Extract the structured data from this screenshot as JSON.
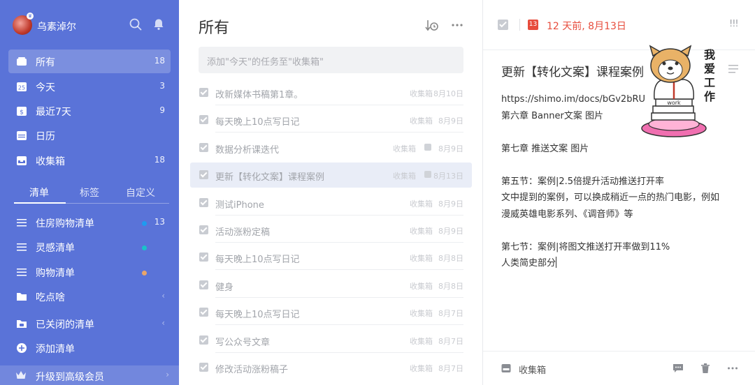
{
  "user": {
    "name": "乌素淖尔"
  },
  "sidebar": {
    "smart_lists": [
      {
        "label": "所有",
        "count": "18"
      },
      {
        "label": "今天",
        "count": "3"
      },
      {
        "label": "最近7天",
        "count": "9"
      },
      {
        "label": "日历",
        "count": ""
      },
      {
        "label": "收集箱",
        "count": "18"
      }
    ],
    "tabs": [
      "清单",
      "标签",
      "自定义"
    ],
    "lists": [
      {
        "label": "住房购物清单",
        "count": "13",
        "dot_color": "#1e9bf0"
      },
      {
        "label": "灵感清单",
        "count": "",
        "dot_color": "#19c3c9"
      },
      {
        "label": "购物清单",
        "count": "",
        "dot_color": "#e9a56a"
      }
    ],
    "folders": [
      {
        "label": "吃点啥"
      },
      {
        "label": "已关闭的清单"
      }
    ],
    "add_list": "添加清单",
    "upgrade": "升级到高级会员",
    "today_icon_day": "25"
  },
  "middle": {
    "title": "所有",
    "add_placeholder": "添加\"今天\"的任务至\"收集箱\"",
    "tasks": [
      {
        "title": "改新媒体书稿第1章。",
        "list": "收集箱",
        "date": "8月10日",
        "note": false
      },
      {
        "title": "每天晚上10点写日记",
        "list": "收集箱",
        "date": "8月9日",
        "note": false
      },
      {
        "title": "数据分析课迭代",
        "list": "收集箱",
        "date": "8月9日",
        "note": true
      },
      {
        "title": "更新【转化文案】课程案例",
        "list": "收集箱",
        "date": "8月13日",
        "note": true
      },
      {
        "title": "测试iPhone",
        "list": "收集箱",
        "date": "8月9日",
        "note": false
      },
      {
        "title": "活动涨粉定稿",
        "list": "收集箱",
        "date": "8月9日",
        "note": false
      },
      {
        "title": "每天晚上10点写日记",
        "list": "收集箱",
        "date": "8月8日",
        "note": false
      },
      {
        "title": "健身",
        "list": "收集箱",
        "date": "8月8日",
        "note": false
      },
      {
        "title": "每天晚上10点写日记",
        "list": "收集箱",
        "date": "8月7日",
        "note": false
      },
      {
        "title": "写公众号文章",
        "list": "收集箱",
        "date": "8月7日",
        "note": false
      },
      {
        "title": "修改活动涨粉稿子",
        "list": "收集箱",
        "date": "8月7日",
        "note": false
      }
    ]
  },
  "detail": {
    "calendar_day": "13",
    "date": "12 天前, 8月13日",
    "priority": "!!!",
    "title": "更新【转化文案】课程案例",
    "body_lines": [
      "https://shimo.im/docs/bGv2bRU",
      "第六章   Banner文案 图片",
      "",
      "第七章  推送文案 图片",
      "",
      "第五节：案例|2.5倍提升活动推送打开率",
      "文中提到的案例，可以换成稍近一点的热门电影，例如",
      "漫威英雄电影系列、《调音师》等",
      "",
      "第七节：案例|将图文推送打开率做到11%",
      "人类简史部分"
    ],
    "sticker": {
      "text_1": "我",
      "text_2": "爱",
      "text_3": "工",
      "text_4": "作",
      "book_label": "work"
    },
    "footer_list": "收集箱"
  },
  "colors": {
    "sidebar_bg": "#5a73d8",
    "accent_red": "#e74c3c"
  }
}
